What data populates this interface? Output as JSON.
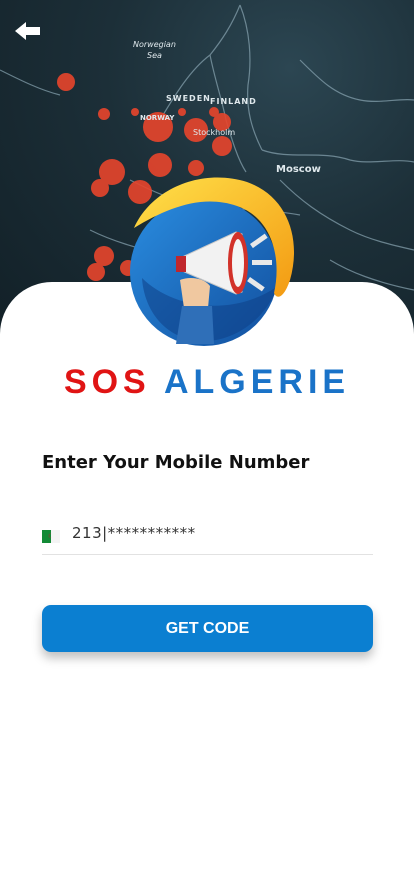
{
  "map": {
    "labels": {
      "norwegian_sea": "Norwegian",
      "norwegian_sea2": "Sea",
      "sweden": "SWEDEN",
      "finland": "FINLAND",
      "norway": "NORWAY",
      "stockholm": "Stockholm",
      "moscow": "Moscow"
    }
  },
  "header": {
    "back_icon": "arrow-left-icon"
  },
  "brand": {
    "part1": "SOS",
    "part2": "ALGERIE",
    "color_red": "#e01414",
    "color_blue": "#1a73c8"
  },
  "form": {
    "heading": "Enter Your Mobile Number",
    "phone_value": "213|***********",
    "flag_icon": "algeria-flag-icon",
    "submit_label": "GET CODE",
    "accent": "#0b7fd1"
  }
}
